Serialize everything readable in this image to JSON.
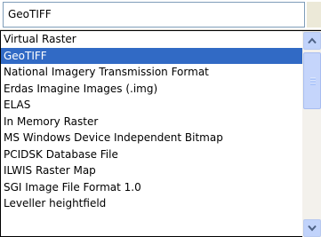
{
  "combo": {
    "selected_value": "GeoTIFF"
  },
  "dropdown": {
    "items": [
      {
        "label": "Virtual Raster",
        "selected": false
      },
      {
        "label": "GeoTIFF",
        "selected": true
      },
      {
        "label": "National Imagery Transmission Format",
        "selected": false
      },
      {
        "label": "Erdas Imagine Images (.img)",
        "selected": false
      },
      {
        "label": "ELAS",
        "selected": false
      },
      {
        "label": "In Memory Raster",
        "selected": false
      },
      {
        "label": "MS Windows Device Independent Bitmap",
        "selected": false
      },
      {
        "label": "PCIDSK Database File",
        "selected": false
      },
      {
        "label": "ILWIS Raster Map",
        "selected": false
      },
      {
        "label": "SGI Image File Format 1.0",
        "selected": false
      },
      {
        "label": "Leveller heightfield",
        "selected": false
      }
    ]
  },
  "colors": {
    "selection": "#316ac5",
    "field_border": "#7f9db9"
  },
  "icons": {
    "scroll_up": "arrow-up-icon",
    "scroll_down": "arrow-down-icon"
  }
}
